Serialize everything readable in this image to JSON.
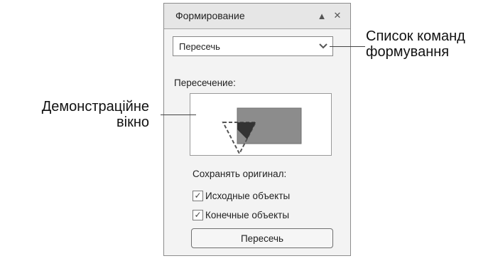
{
  "docker": {
    "title": "Формирование",
    "collapse_icon": "triangle-up-icon",
    "close_icon": "close-icon",
    "command_select": {
      "value": "Пересечь"
    },
    "section_label": "Пересечение:",
    "keep_label": "Сохранять оригинал:",
    "checkboxes": [
      {
        "label": "Исходные объекты",
        "checked": true
      },
      {
        "label": "Конечные объекты",
        "checked": true
      }
    ],
    "apply_button": "Пересечь"
  },
  "callouts": {
    "right": {
      "line1": "Список команд",
      "line2": "формування"
    },
    "left": {
      "line1": "Демонстраційне",
      "line2": "вікно"
    }
  },
  "colors": {
    "rect_fill": "#8c8c8c",
    "triangle_stroke": "#555555",
    "intersection_fill": "#333333"
  }
}
